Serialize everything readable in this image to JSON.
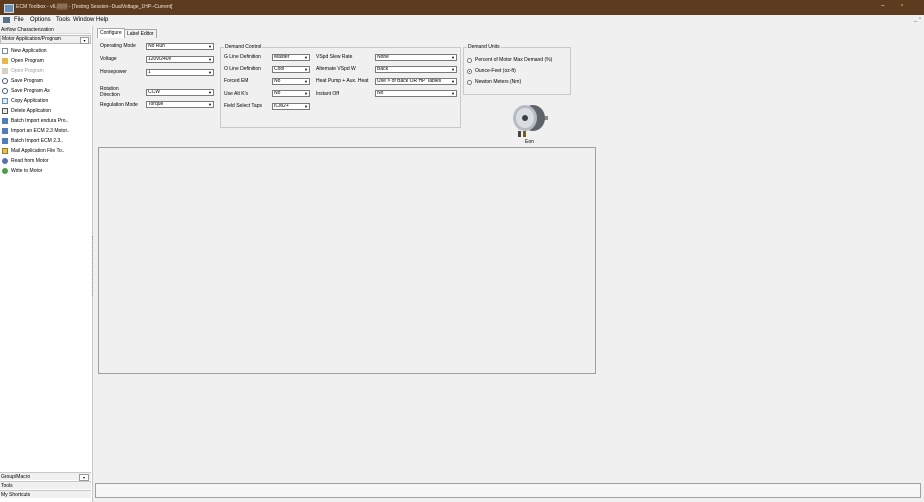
{
  "window": {
    "title": "ECM Toolbox - v6.▒▒▒ - [Testing Session--DualVoltage_1HP--Current]",
    "minimize": "–",
    "maximize": "▫"
  },
  "menu": {
    "items": [
      "File",
      "Options",
      "Tools",
      "Window",
      "Help"
    ],
    "restore": "_ ▫"
  },
  "sidebar": {
    "section_top": "Airflow Characterization",
    "combo_value": "Motor Application/Program",
    "items": [
      {
        "label": "New Application",
        "icon": "new-document-icon",
        "enabled": true
      },
      {
        "label": "Open Program",
        "icon": "folder-icon",
        "enabled": true
      },
      {
        "label": "Open Program",
        "icon": "folder-icon",
        "enabled": false
      },
      {
        "label": "Save Program",
        "icon": "save-icon",
        "enabled": true
      },
      {
        "label": "Save Program As",
        "icon": "save-as-icon",
        "enabled": true
      },
      {
        "label": "Copy Application",
        "icon": "copy-icon",
        "enabled": true
      },
      {
        "label": "Delete Application",
        "icon": "delete-icon",
        "enabled": true
      },
      {
        "label": "Batch Import endura Pro..",
        "icon": "batch-import-icon",
        "enabled": true
      },
      {
        "label": "Import an ECM 2.3 Motor..",
        "icon": "import-icon",
        "enabled": true
      },
      {
        "label": "Batch Import ECM 2.3..",
        "icon": "batch-import-icon",
        "enabled": true
      },
      {
        "label": "Mail Application File To..",
        "icon": "mail-icon",
        "enabled": true
      },
      {
        "label": "Read from Motor",
        "icon": "read-motor-icon",
        "enabled": true
      },
      {
        "label": "Write to Motor",
        "icon": "write-motor-icon",
        "enabled": true
      }
    ],
    "bottom": {
      "group_macro": "Group/Macro",
      "tools": "Tools",
      "shortcuts": "My Shortcuts"
    }
  },
  "tabs": [
    "Configure",
    "Label Editor"
  ],
  "configure": {
    "operating_mode_label": "Operating Mode",
    "operating_mode_value": "No Run",
    "voltage_label": "Voltage",
    "voltage_value": "120v/240v",
    "horsepower_label": "Horsepower",
    "horsepower_value": "1",
    "rotation_label_1": "Rotation",
    "rotation_label_2": "Direction",
    "rotation_value": "CCW",
    "regulation_label": "Regulation Mode",
    "regulation_value": "Torque"
  },
  "demand_control": {
    "title": "Demand Control",
    "g_line_label": "G Line Definition",
    "g_line_value": "Master",
    "o_line_label": "O Line Definition",
    "o_line_value": "Cool",
    "forced_em_label": "Forced EM",
    "forced_em_value": "No",
    "use_alt_label": "Use Alt K's",
    "use_alt_value": "No",
    "field_select_label": "Field Select Taps",
    "field_select_value": "ICM2+",
    "vspd_slew_label": "VSpd Slew Rate",
    "vspd_slew_value": "None",
    "alt_vspd_label": "Alternate VSpd W",
    "alt_vspd_value": "Back",
    "heat_pump_label": "Heat Pump + Aux. Heat",
    "heat_pump_value": "Use > of Back OR HP Tables",
    "instant_off_label": "Instant Off",
    "instant_off_value": "No"
  },
  "demand_units": {
    "title": "Demand Units",
    "options": [
      {
        "label": "Percent of Motor Max Demand (%)",
        "selected": false
      },
      {
        "label": "Ounce-Feet (oz-ft)",
        "selected": true
      },
      {
        "label": "Newton Meters (Nm)",
        "selected": false
      }
    ]
  },
  "motor": {
    "caption": "Eon"
  },
  "colors": {
    "titlebar": "#5c3b1e",
    "background": "#f0f0f0"
  }
}
